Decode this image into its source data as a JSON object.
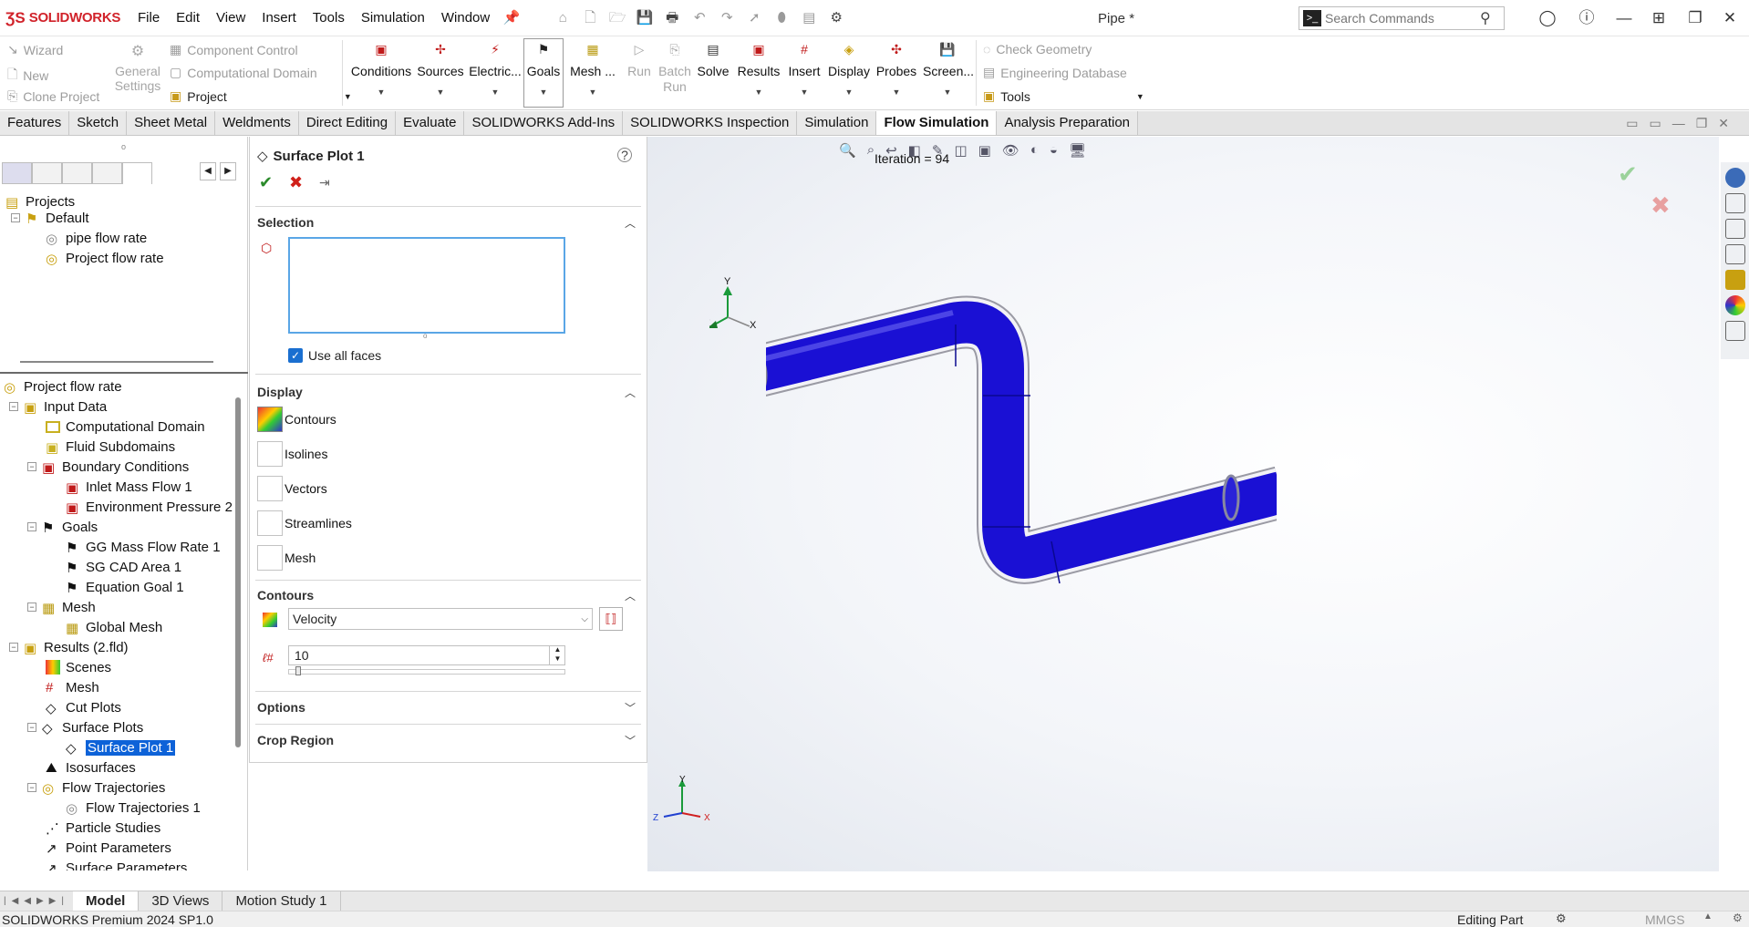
{
  "app": {
    "brand": "SOLIDWORKS",
    "document_title": "Pipe *",
    "menu": [
      "File",
      "Edit",
      "View",
      "Insert",
      "Tools",
      "Simulation",
      "Window"
    ]
  },
  "search": {
    "placeholder": "Search Commands"
  },
  "ribbon": {
    "left_group": [
      "Wizard",
      "New",
      "Clone Project"
    ],
    "general_settings": "General Settings",
    "mid_group": [
      "Component Control",
      "Computational Domain",
      "Project"
    ],
    "buttons": [
      "Conditions",
      "Sources",
      "Electric...",
      "Goals",
      "Mesh ...",
      "Run",
      "Batch Run",
      "Solve",
      "Results",
      "Insert",
      "Display",
      "Probes",
      "Screen..."
    ],
    "right_group": [
      "Check Geometry",
      "Engineering Database",
      "Tools"
    ]
  },
  "tabs": [
    "Features",
    "Sketch",
    "Sheet Metal",
    "Weldments",
    "Direct Editing",
    "Evaluate",
    "SOLIDWORKS Add-Ins",
    "SOLIDWORKS Inspection",
    "Simulation",
    "Flow Simulation",
    "Analysis Preparation"
  ],
  "active_tab": "Flow Simulation",
  "projects_tree": {
    "root": "Projects",
    "default": "Default",
    "items": [
      "pipe flow rate",
      "Project flow rate"
    ]
  },
  "analysis_tree": {
    "root": "Project flow rate",
    "input_data": "Input Data",
    "computational_domain": "Computational Domain",
    "fluid_subdomains": "Fluid Subdomains",
    "boundary_conditions": "Boundary Conditions",
    "inlet": "Inlet Mass Flow 1",
    "env_pressure": "Environment Pressure 2",
    "goals": "Goals",
    "goal1": "GG Mass Flow Rate 1",
    "goal2": "SG CAD Area 1",
    "goal3": "Equation Goal 1",
    "mesh": "Mesh",
    "global_mesh": "Global Mesh",
    "results": "Results (2.fld)",
    "scenes": "Scenes",
    "results_mesh": "Mesh",
    "cut_plots": "Cut Plots",
    "surface_plots": "Surface Plots",
    "surface_plot_1": "Surface Plot 1",
    "isosurfaces": "Isosurfaces",
    "flow_trajectories": "Flow Trajectories",
    "flow_trajectories_1": "Flow Trajectories 1",
    "particle_studies": "Particle Studies",
    "point_parameters": "Point Parameters",
    "surface_parameters": "Surface Parameters"
  },
  "property_manager": {
    "title": "Surface Plot 1",
    "selection_header": "Selection",
    "use_all_faces": "Use all faces",
    "use_all_faces_checked": true,
    "display_header": "Display",
    "display_options": [
      "Contours",
      "Isolines",
      "Vectors",
      "Streamlines",
      "Mesh"
    ],
    "contours_header": "Contours",
    "parameter": "Velocity",
    "levels": "10",
    "options_header": "Options",
    "crop_header": "Crop Region"
  },
  "graphics": {
    "iteration_text": "Iteration = 94",
    "pipe_color": "#1a10d4",
    "inlet_color": "#7a9a12"
  },
  "bottom_tabs": [
    "Model",
    "3D Views",
    "Motion Study 1"
  ],
  "status": {
    "left": "SOLIDWORKS Premium 2024 SP1.0",
    "mode": "Editing Part",
    "units": "MMGS"
  }
}
